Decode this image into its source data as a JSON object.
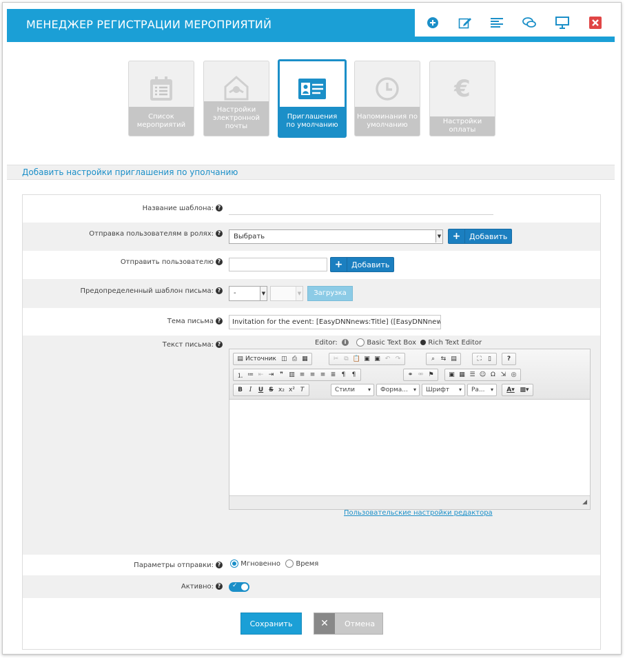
{
  "header": {
    "title": "МЕНЕДЖЕР РЕГИСТРАЦИИ МЕРОПРИЯТИЙ",
    "icons": [
      "plus-circle-icon",
      "edit-icon",
      "list-icon",
      "chat-icon",
      "monitor-icon",
      "close-icon"
    ],
    "accent": "#1b9fd6",
    "close_color": "#e04545"
  },
  "tiles": [
    {
      "label": "Список мероприятий",
      "icon": "calendar-list-icon",
      "active": false
    },
    {
      "label": "Настройки электронной почты",
      "icon": "email-settings-icon",
      "active": false
    },
    {
      "label": "Приглашения по умолчанию",
      "icon": "id-card-icon",
      "active": true
    },
    {
      "label": "Напоминания по умолчанию",
      "icon": "clock-icon",
      "active": false
    },
    {
      "label": "Настройки оплаты",
      "icon": "euro-icon",
      "active": false
    }
  ],
  "section_title": "Добавить настройки приглашения по уполчанию",
  "form": {
    "template_name": {
      "label": "Название шаблона:",
      "value": ""
    },
    "roles": {
      "label": "Отправка пользователям в ролях:",
      "selected": "Выбрать",
      "add_label": "Добавить"
    },
    "user": {
      "label": "Отправить пользователю",
      "value": "",
      "add_label": "Добавить"
    },
    "predefined": {
      "label": "Предопределенный шаблон письма:",
      "selected": "-",
      "selected2": "",
      "load_label": "Загрузка"
    },
    "subject": {
      "label": "Тема письма",
      "value": "Invitation for the event: [EasyDNNnews:Title] ([EasyDNNnews"
    },
    "body": {
      "label": "Текст письма:",
      "editor_label": "Editor:",
      "basic_option": "Basic Text Box",
      "rich_option": "Rich Text Editor",
      "source_label": "Источник",
      "styles_label": "Стили",
      "format_label": "Форма...",
      "font_label": "Шрифт",
      "size_label": "Ра...",
      "settings_link": "Пользовательские настройки редактора"
    },
    "send_params": {
      "label": "Параметры отправки:",
      "instant": "Мгновенно",
      "time": "Время"
    },
    "active": {
      "label": "Активно:",
      "on": true
    }
  },
  "actions": {
    "save": "Сохранить",
    "cancel": "Отмена"
  }
}
